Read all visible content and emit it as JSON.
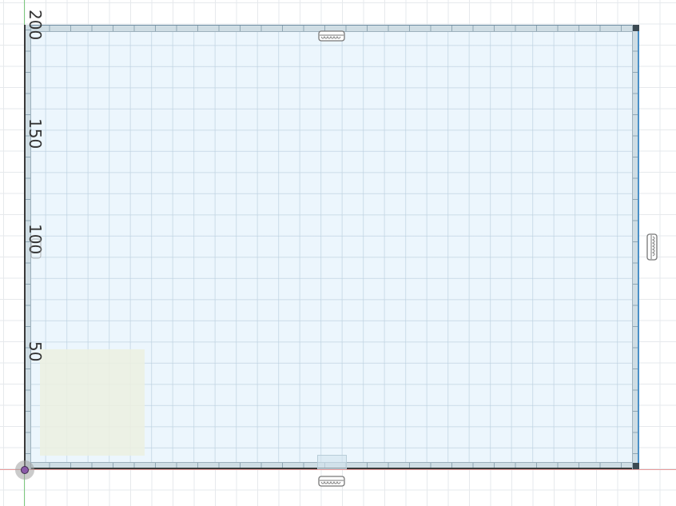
{
  "canvas": {
    "grid_color": "#e6e9ec",
    "plane_color": "#dceefc",
    "axis_x_color": "#e89a9a",
    "axis_y_color": "#7dc87d"
  },
  "dimensions": {
    "labels": [
      "200",
      "150",
      "100",
      "50"
    ]
  },
  "icons": {
    "origin": "origin-point-icon",
    "resize_handle": "resize-grip-icon"
  }
}
